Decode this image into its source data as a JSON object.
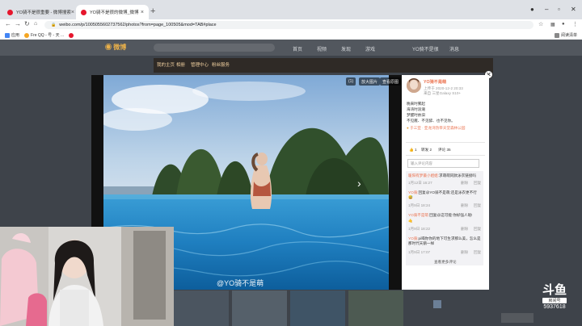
{
  "browser": {
    "tabs": [
      {
        "title": "YO骑不是很重要 - 微博搜索"
      },
      {
        "title": "YO骑不是很的微博_微博"
      }
    ],
    "address": "weibo.com/p/1005055602737562/photos?from=page_100505&mod=TAB#place",
    "bookmarks": [
      "应用",
      "Fre QQ - 号 - 天 ..."
    ],
    "bookmarks_right": "阅读清单"
  },
  "weibo": {
    "logo": "微博",
    "nav_items": [
      "首页",
      "视频",
      "发现",
      "游戏",
      "YO骑不是很",
      "消息"
    ],
    "profile_tabs": [
      "我的主页",
      "相册",
      "管理中心",
      "粉丝服务"
    ]
  },
  "viewer": {
    "buttons": [
      "(1)",
      "放大图片",
      "查看原图"
    ],
    "watermark": "@YO骑不是萌",
    "next": "›"
  },
  "post": {
    "author": "YO骑不是萌",
    "time": "上传于 2020-12-2 20:33",
    "device": "来自 三星Galaxy S10+",
    "lines": [
      "晚来时雾起",
      "海湾时浪潮",
      "梦醒时依旧",
      "不见雁、不见醉、也不见你。"
    ],
    "location": "于三亚 · 亚龙湾热带天堂森林公园",
    "stats": {
      "likes": "1",
      "forward": "转发 2",
      "comments": "评论 35"
    }
  },
  "comments": {
    "placeholder": "输入评论内容",
    "items": [
      {
        "user": "暖阳有梦最小姐姐:",
        "text": "求萌萌同款泳衣链接吗",
        "date": "1月12日 16:27",
        "actions": [
          "删除",
          "回复"
        ]
      },
      {
        "user": "YO骑:",
        "text": "回复@YO骑不是萌:还是泳衣更不行",
        "date": "1月9日 18:24",
        "actions": [
          "删除",
          "回复"
        ]
      },
      {
        "user": "YO骑不是萌",
        "text": "回复@这可能:你好强人呢!",
        "date": "1月9日 18:22",
        "actions": [
          "删除",
          "回复"
        ]
      },
      {
        "user": "YO骑:",
        "text": "pi喝你你的地下可生求那么美，怎么是那时代天鹅一样",
        "date": "1月9日 17:07",
        "actions": [
          "删除",
          "回复"
        ]
      }
    ],
    "more": "查看更多评论"
  },
  "overlay": {
    "brand": "斗鱼",
    "sub": "房间号",
    "room": "5937618"
  }
}
